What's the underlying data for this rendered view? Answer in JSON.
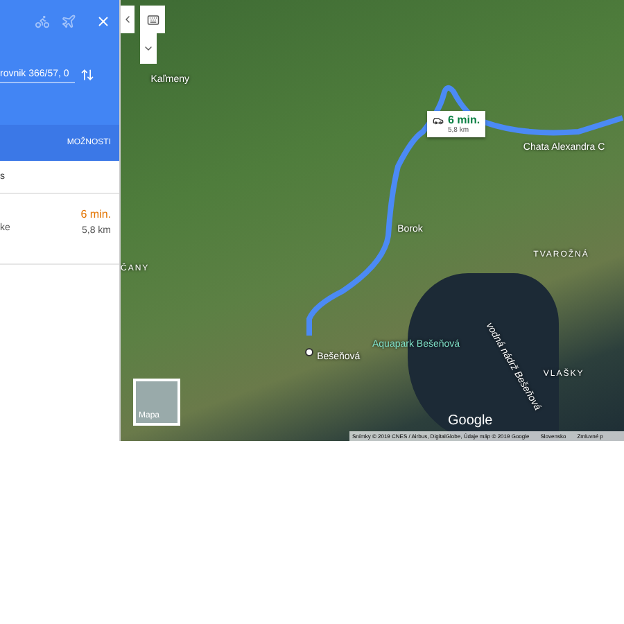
{
  "panel": {
    "travel_modes": [
      {
        "kind": "bike",
        "selected": false
      },
      {
        "kind": "plane",
        "selected": false
      }
    ],
    "destination": {
      "value": "rovnik 366/57, 0"
    },
    "options_label": "MOŽNOSTI",
    "summary": "s",
    "route": {
      "time": "6 min.",
      "via": "ke",
      "distance": "5,8 km"
    }
  },
  "map": {
    "route_bubble": {
      "time": "6 min.",
      "distance": "5,8 km"
    },
    "labels": [
      {
        "text": "Kaľmeny",
        "kind": "village"
      },
      {
        "text": "Chata Alexandra C",
        "kind": "poi"
      },
      {
        "text": "Borok",
        "kind": "village"
      },
      {
        "text": "TVAROŽNÁ",
        "kind": "area"
      },
      {
        "text": "ČANY",
        "kind": "area"
      },
      {
        "text": "Aquapark Bešeňová",
        "kind": "park"
      },
      {
        "text": "Bešeňová",
        "kind": "town"
      },
      {
        "text": "VLAŠKY",
        "kind": "area"
      },
      {
        "text": "vodná nádrž Bešeňová",
        "kind": "water"
      }
    ],
    "layer_button": "Mapa",
    "logo": "Google",
    "attribution": "Snímky © 2019 CNES / Airbus, DigitalGlobe, Údaje máp © 2019 Google",
    "region": "Slovensko",
    "terms": "Zmluvné p"
  }
}
